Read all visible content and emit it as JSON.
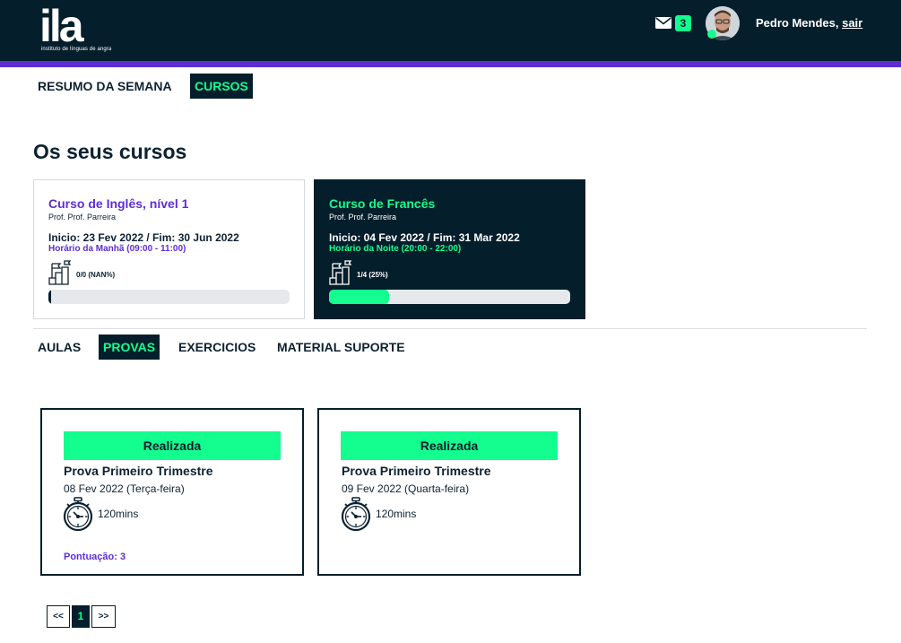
{
  "brand": {
    "logo_mark": "ila",
    "logo_subtitle": "instituto de línguas de angra"
  },
  "header": {
    "unread_count": "3",
    "user_name": "Pedro Mendes,",
    "logout_label": "sair"
  },
  "main_nav": {
    "items": [
      {
        "label": "RESUMO DA SEMANA",
        "active": false
      },
      {
        "label": "CURSOS",
        "active": true
      }
    ]
  },
  "courses_section": {
    "title": "Os seus cursos",
    "courses": [
      {
        "title": "Curso de Inglês, nível 1",
        "professor": "Prof. Prof. Parreira",
        "dates": "Inicio: 23 Fev 2022 / Fim: 30 Jun 2022",
        "schedule": "Horário da Manhã (09:00 - 11:00)",
        "progress_text": "0/0 (NAN%)",
        "progress_fraction": 0,
        "selected": false
      },
      {
        "title": "Curso de Francês",
        "professor": "Prof. Prof. Parreira",
        "dates": "Inicio: 04 Fev 2022 / Fim: 31 Mar 2022",
        "schedule": "Horário da Noite (20:00 - 22:00)",
        "progress_text": "1/4 (25%)",
        "progress_fraction": 0.25,
        "selected": true
      }
    ]
  },
  "course_tabs": {
    "items": [
      {
        "label": "AULAS",
        "active": false
      },
      {
        "label": "PROVAS",
        "active": true
      },
      {
        "label": "EXERCICIOS",
        "active": false
      },
      {
        "label": "MATERIAL SUPORTE",
        "active": false
      }
    ]
  },
  "exams": [
    {
      "status": "Realizada",
      "title": "Prova Primeiro Trimestre",
      "date": "08 Fev 2022 (Terça-feira)",
      "duration": "120mins",
      "score": "Pontuação: 3"
    },
    {
      "status": "Realizada",
      "title": "Prova Primeiro Trimestre",
      "date": "09 Fev 2022 (Quarta-feira)",
      "duration": "120mins",
      "score": ""
    }
  ],
  "pagination": {
    "prev_label": "<<",
    "current_page": "1",
    "next_label": ">>"
  },
  "colors": {
    "navy": "#051e2b",
    "accent_green": "#14fd8f",
    "accent_purple": "#5d2ed3"
  }
}
